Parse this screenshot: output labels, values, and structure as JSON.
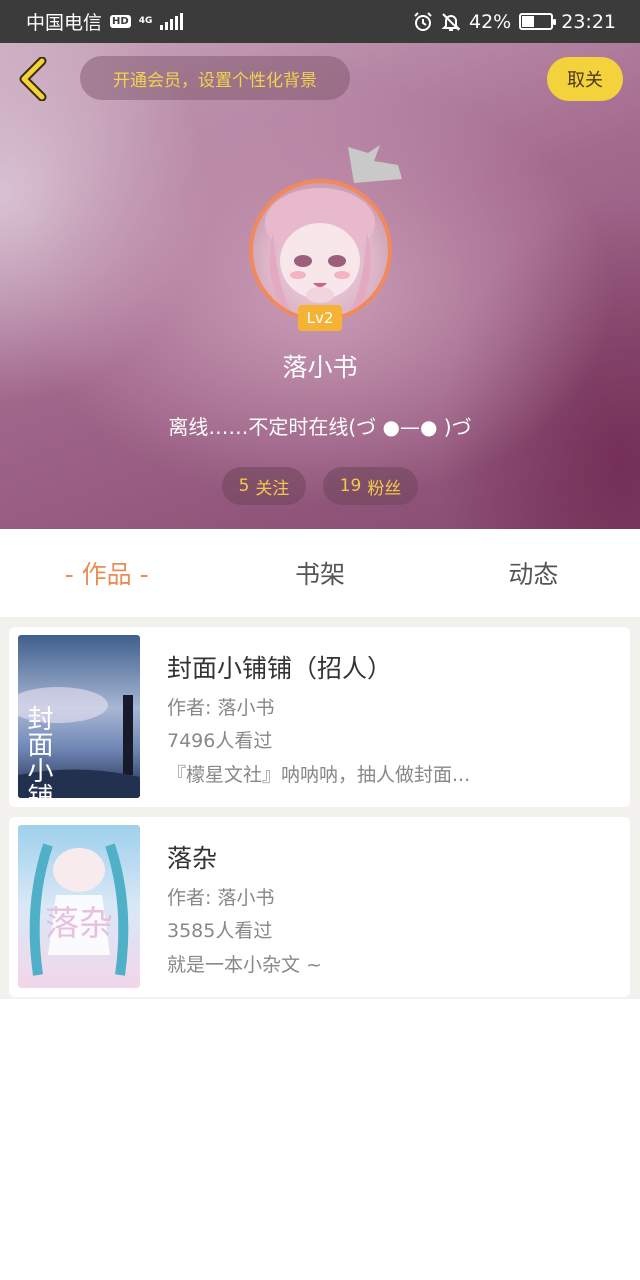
{
  "status_bar": {
    "carrier": "中国电信",
    "hd": "HD",
    "network": "4G",
    "battery": "42%",
    "time": "23:21"
  },
  "header": {
    "vip_banner": "开通会员，设置个性化背景",
    "unfollow_label": "取关",
    "level": "Lv2",
    "username": "落小书",
    "bio": "离线……不定时在线(づ ●—● )づ",
    "following_count": "5",
    "following_label": "关注",
    "followers_count": "19",
    "followers_label": "粉丝"
  },
  "tabs": [
    {
      "label": "- 作品 -",
      "active": true
    },
    {
      "label": "书架",
      "active": false
    },
    {
      "label": "动态",
      "active": false
    }
  ],
  "books": [
    {
      "title": "封面小铺铺（招人）",
      "author": "作者: 落小书",
      "views": "7496人看过",
      "summary": "『檬星文社』呐呐呐，抽人做封面...",
      "cover_text": "封面小铺"
    },
    {
      "title": "落杂",
      "author": "作者: 落小书",
      "views": "3585人看过",
      "summary": "就是一本小杂文 ~",
      "cover_text": "落杂"
    }
  ],
  "colors": {
    "accent": "#ea8d55",
    "yellow": "#f4d23c",
    "stat_text": "#f4c94a"
  }
}
